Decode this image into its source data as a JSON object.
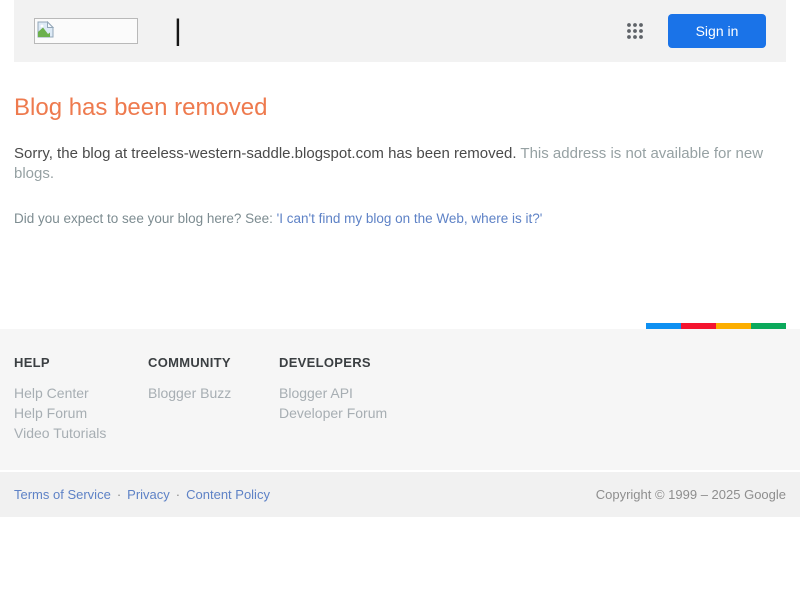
{
  "header": {
    "cursor": "|",
    "sign_in_label": "Sign in"
  },
  "icons": {
    "logo": "broken-image-icon",
    "apps": "apps-grid-icon"
  },
  "main": {
    "title": "Blog has been removed",
    "message_primary": "Sorry, the blog at treeless-western-saddle.blogspot.com has been removed.",
    "message_secondary": "This address is not available for new blogs.",
    "question": "Did you expect to see your blog here? See: ",
    "link_label": "'I can't find my blog on the Web, where is it?'"
  },
  "stripe": {
    "colors": [
      "#0e90f2",
      "#f4142f",
      "#fcae00",
      "#0ba95b"
    ]
  },
  "footer": {
    "columns": [
      {
        "heading": "HELP",
        "links": [
          "Help Center",
          "Help Forum",
          "Video Tutorials"
        ]
      },
      {
        "heading": "COMMUNITY",
        "links": [
          "Blogger Buzz"
        ]
      },
      {
        "heading": "DEVELOPERS",
        "links": [
          "Blogger API",
          "Developer Forum"
        ]
      }
    ],
    "legal_links": [
      "Terms of Service",
      "Privacy",
      "Content Policy"
    ],
    "legal_separator": "·",
    "copyright": "Copyright © 1999 – 2025 Google"
  },
  "colors": {
    "header_background": "#f2f2f2",
    "signin_blue": "#1a73e8",
    "title_orange": "#ee7a4e",
    "link_blue": "#5e82c6",
    "footer_link_gray": "#a7aeb3"
  }
}
